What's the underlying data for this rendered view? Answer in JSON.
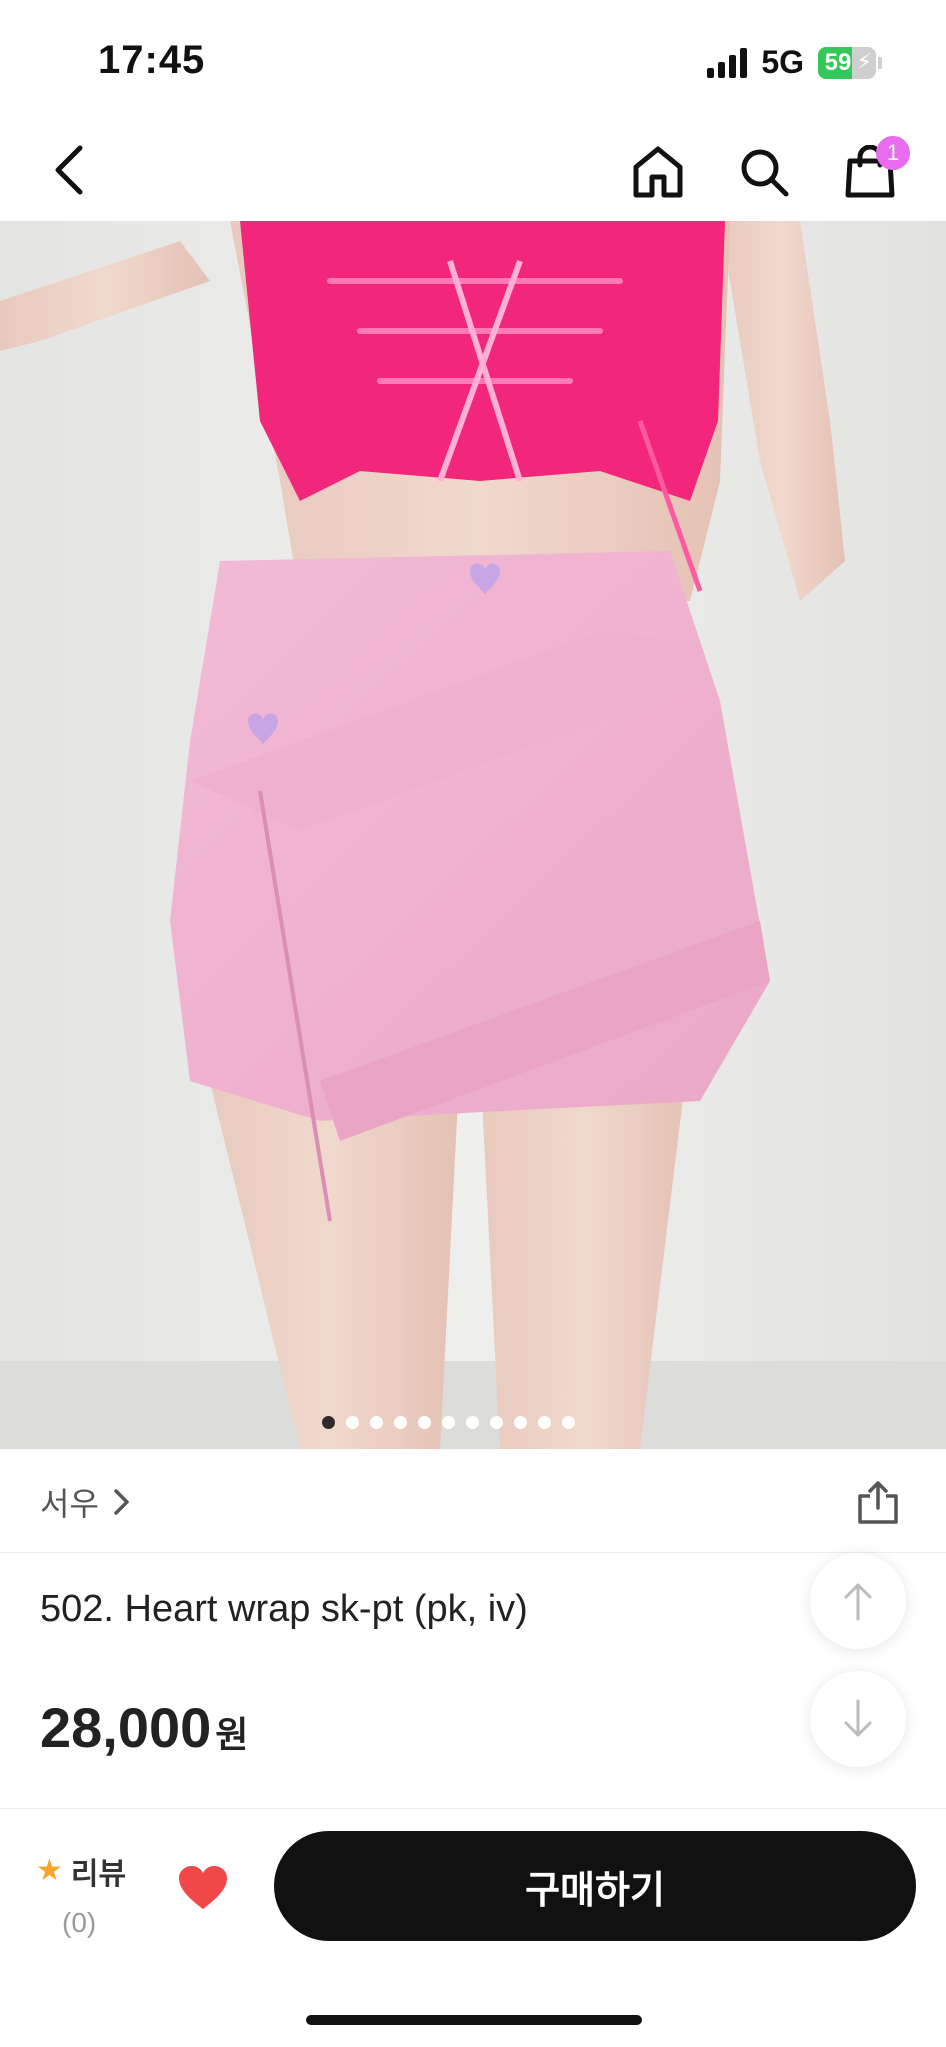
{
  "status_bar": {
    "time": "17:45",
    "network": "5G",
    "battery_percent": "59",
    "battery_level": 0.59,
    "battery_color": "#34c759"
  },
  "nav": {
    "back_icon": "chevron-left-icon",
    "home_icon": "home-icon",
    "search_icon": "search-icon",
    "cart_icon": "shopping-bag-icon",
    "cart_badge": "1",
    "badge_color": "#e86bf0"
  },
  "product_image": {
    "description_icon": "product-photo",
    "dot_count": 11,
    "active_dot": 0
  },
  "seller": {
    "name": "서우",
    "chevron_icon": "chevron-right-icon",
    "share_icon": "share-icon"
  },
  "product": {
    "name": "502. Heart wrap sk-pt (pk, iv)",
    "price": "28,000",
    "currency": "원"
  },
  "scroll": {
    "up_icon": "arrow-up-icon",
    "down_icon": "arrow-down-icon"
  },
  "bottom_bar": {
    "review_icon": "star-icon",
    "review_label": "리뷰",
    "review_count": "(0)",
    "like_icon": "heart-icon",
    "like_color": "#f04848",
    "buy_label": "구매하기",
    "buy_color": "#111111"
  }
}
